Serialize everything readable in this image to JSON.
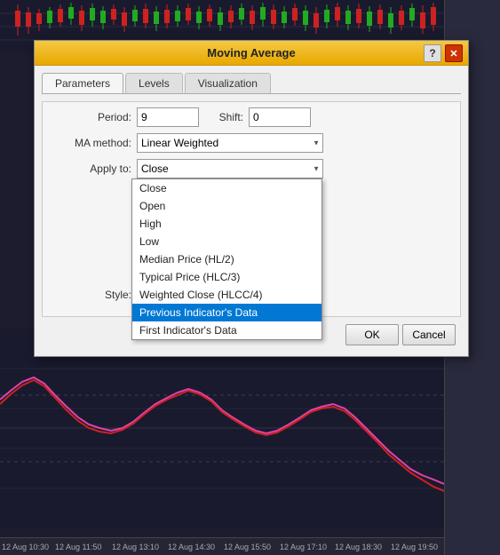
{
  "chart": {
    "background_color": "#1a1a2e",
    "time_labels": [
      "12 Aug 10:30",
      "12 Aug 11:50",
      "12 Aug 13:10",
      "12 Aug 14:30",
      "12 Aug 15:50",
      "12 Aug 17:10",
      "12 Aug 18:30",
      "12 Aug 19:50"
    ]
  },
  "dialog": {
    "title": "Moving Average",
    "help_label": "?",
    "close_label": "✕",
    "tabs": [
      {
        "label": "Parameters",
        "active": true
      },
      {
        "label": "Levels",
        "active": false
      },
      {
        "label": "Visualization",
        "active": false
      }
    ],
    "form": {
      "period_label": "Period:",
      "period_value": "9",
      "shift_label": "Shift:",
      "shift_value": "0",
      "ma_method_label": "MA method:",
      "ma_method_value": "Linear Weighted",
      "apply_to_label": "Apply to:",
      "apply_to_value": "Close",
      "style_label": "Style:",
      "style_color": "Red"
    },
    "dropdown": {
      "items": [
        "Close",
        "Open",
        "High",
        "Low",
        "Median Price (HL/2)",
        "Typical Price (HLC/3)",
        "Weighted Close (HLCC/4)",
        "Previous Indicator's Data",
        "First Indicator's Data"
      ],
      "selected": "Previous Indicator's Data"
    },
    "buttons": {
      "ok_label": "OK",
      "cancel_label": "Cancel"
    }
  }
}
